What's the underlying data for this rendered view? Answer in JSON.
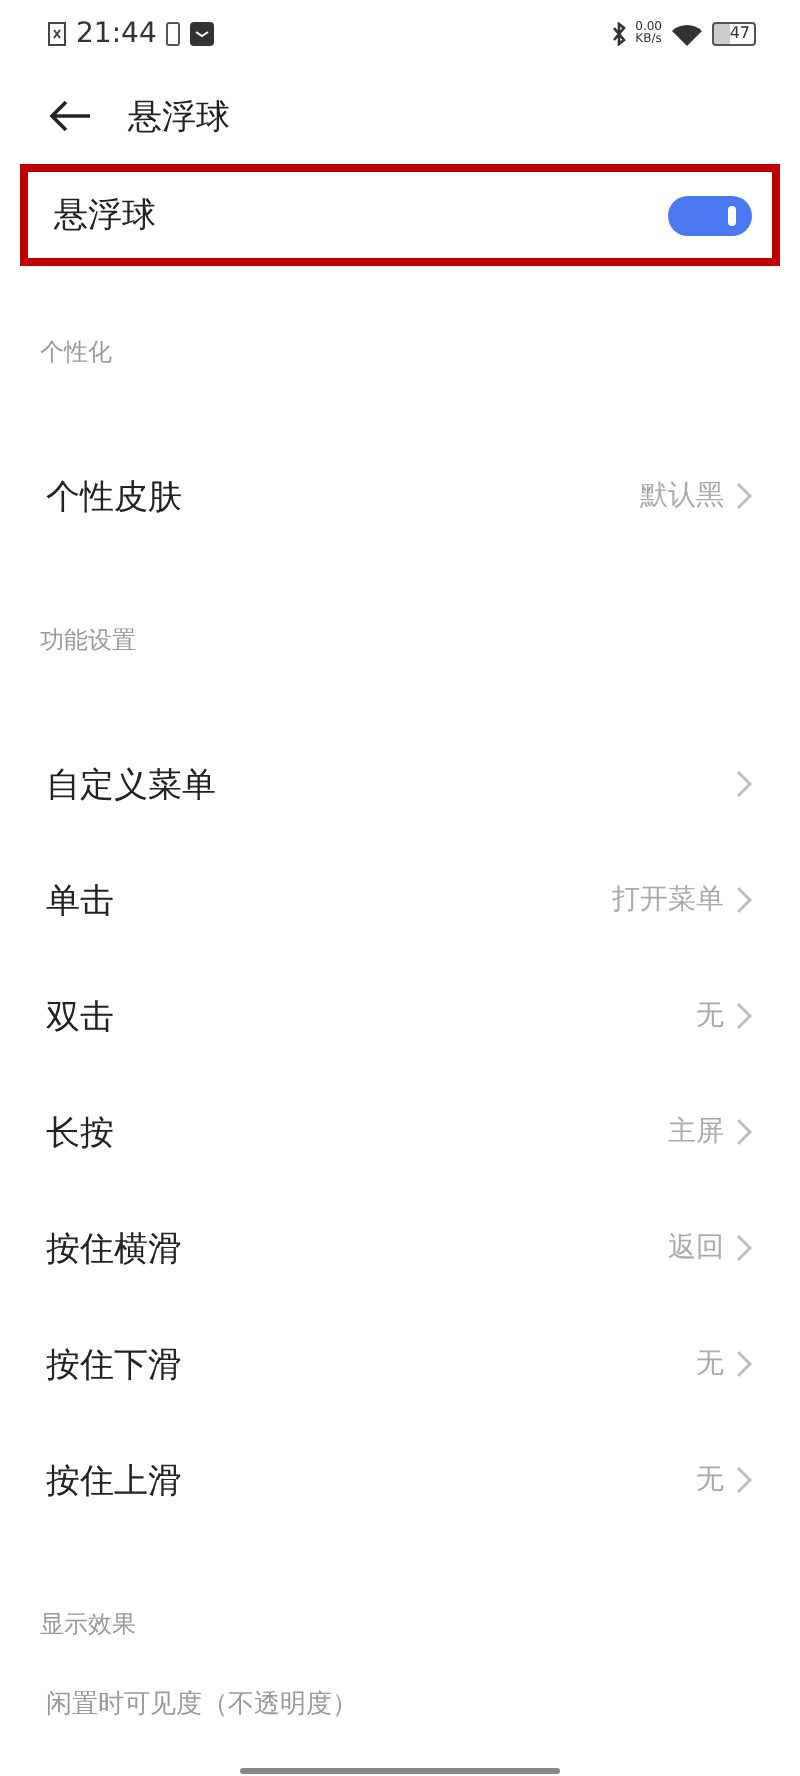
{
  "status_bar": {
    "time": "21:44",
    "net_speed": "0.00",
    "net_unit": "KB/s",
    "battery": "47"
  },
  "header": {
    "title": "悬浮球"
  },
  "main_toggle": {
    "label": "悬浮球",
    "on": true,
    "highlighted": true
  },
  "sections": [
    {
      "title": "个性化",
      "items": [
        {
          "label": "个性皮肤",
          "value": "默认黑"
        }
      ]
    },
    {
      "title": "功能设置",
      "items": [
        {
          "label": "自定义菜单"
        },
        {
          "label": "单击",
          "value": "打开菜单"
        },
        {
          "label": "双击",
          "value": "无"
        },
        {
          "label": "长按",
          "value": "主屏"
        },
        {
          "label": "按住横滑",
          "value": "返回"
        },
        {
          "label": "按住下滑",
          "value": "无"
        },
        {
          "label": "按住上滑",
          "value": "无"
        }
      ]
    },
    {
      "title": "显示效果"
    }
  ],
  "partial_item": {
    "label": "闲置时可见度（不透明度）"
  }
}
